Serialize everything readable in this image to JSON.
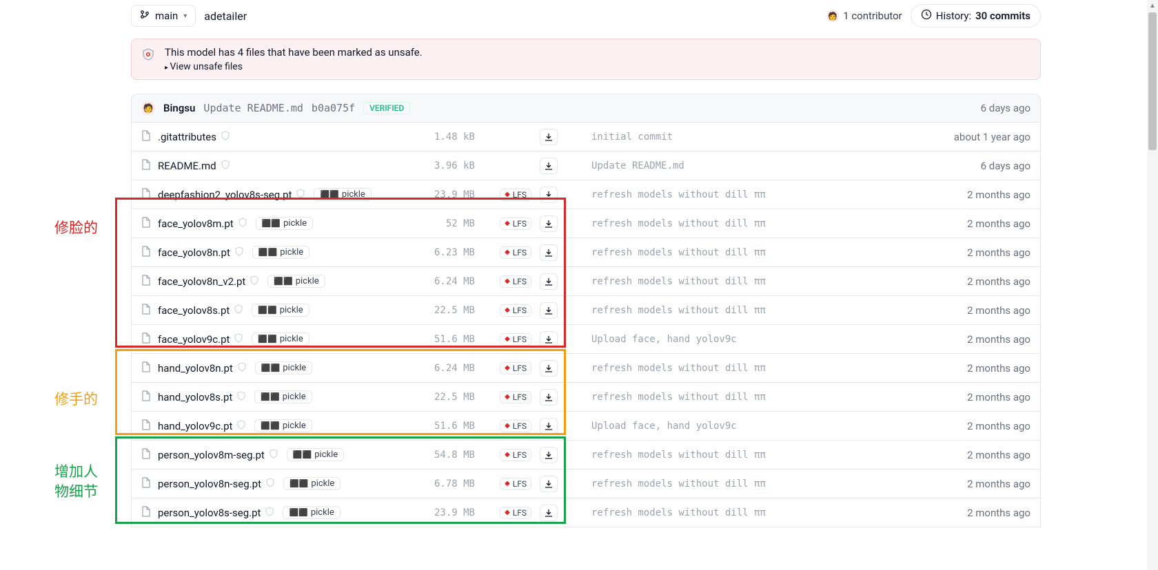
{
  "header": {
    "branch": "main",
    "repoName": "adetailer",
    "contributorCount": "1 contributor",
    "historyLabel": "History:",
    "historyCount": "30 commits"
  },
  "unsafe": {
    "message": "This model has 4 files that have been marked as unsafe.",
    "link": "View unsafe files"
  },
  "commit": {
    "author": "Bingsu",
    "message": "Update README.md",
    "hash": "b0a075f",
    "verified": "VERIFIED",
    "when": "6 days ago"
  },
  "annotations": {
    "red": "修脸的",
    "orange": "修手的",
    "green": "增加人物细节"
  },
  "pickleLabel": "pickle",
  "lfsLabel": "LFS",
  "files": [
    {
      "name": ".gitattributes",
      "size": "1.48 kB",
      "pickle": false,
      "lfs": false,
      "commitMsg": "initial commit",
      "when": "about 1 year ago"
    },
    {
      "name": "README.md",
      "size": "3.96 kB",
      "pickle": false,
      "lfs": false,
      "commitMsg": "Update README.md",
      "when": "6 days ago"
    },
    {
      "name": "deepfashion2_yolov8s-seg.pt",
      "size": "23.9 MB",
      "pickle": true,
      "lfs": true,
      "commitMsg": "refresh models without dill ππ",
      "when": "2 months ago"
    },
    {
      "name": "face_yolov8m.pt",
      "size": "52 MB",
      "pickle": true,
      "lfs": true,
      "commitMsg": "refresh models without dill ππ",
      "when": "2 months ago"
    },
    {
      "name": "face_yolov8n.pt",
      "size": "6.23 MB",
      "pickle": true,
      "lfs": true,
      "commitMsg": "refresh models without dill ππ",
      "when": "2 months ago"
    },
    {
      "name": "face_yolov8n_v2.pt",
      "size": "6.24 MB",
      "pickle": true,
      "lfs": true,
      "commitMsg": "refresh models without dill ππ",
      "when": "2 months ago"
    },
    {
      "name": "face_yolov8s.pt",
      "size": "22.5 MB",
      "pickle": true,
      "lfs": true,
      "commitMsg": "refresh models without dill ππ",
      "when": "2 months ago"
    },
    {
      "name": "face_yolov9c.pt",
      "size": "51.6 MB",
      "pickle": true,
      "lfs": true,
      "commitMsg": "Upload face, hand yolov9c",
      "when": "2 months ago"
    },
    {
      "name": "hand_yolov8n.pt",
      "size": "6.24 MB",
      "pickle": true,
      "lfs": true,
      "commitMsg": "refresh models without dill ππ",
      "when": "2 months ago"
    },
    {
      "name": "hand_yolov8s.pt",
      "size": "22.5 MB",
      "pickle": true,
      "lfs": true,
      "commitMsg": "refresh models without dill ππ",
      "when": "2 months ago"
    },
    {
      "name": "hand_yolov9c.pt",
      "size": "51.6 MB",
      "pickle": true,
      "lfs": true,
      "commitMsg": "Upload face, hand yolov9c",
      "when": "2 months ago"
    },
    {
      "name": "person_yolov8m-seg.pt",
      "size": "54.8 MB",
      "pickle": true,
      "lfs": true,
      "commitMsg": "refresh models without dill ππ",
      "when": "2 months ago"
    },
    {
      "name": "person_yolov8n-seg.pt",
      "size": "6.78 MB",
      "pickle": true,
      "lfs": true,
      "commitMsg": "refresh models without dill ππ",
      "when": "2 months ago"
    },
    {
      "name": "person_yolov8s-seg.pt",
      "size": "23.9 MB",
      "pickle": true,
      "lfs": true,
      "commitMsg": "refresh models without dill ππ",
      "when": "2 months ago"
    }
  ]
}
